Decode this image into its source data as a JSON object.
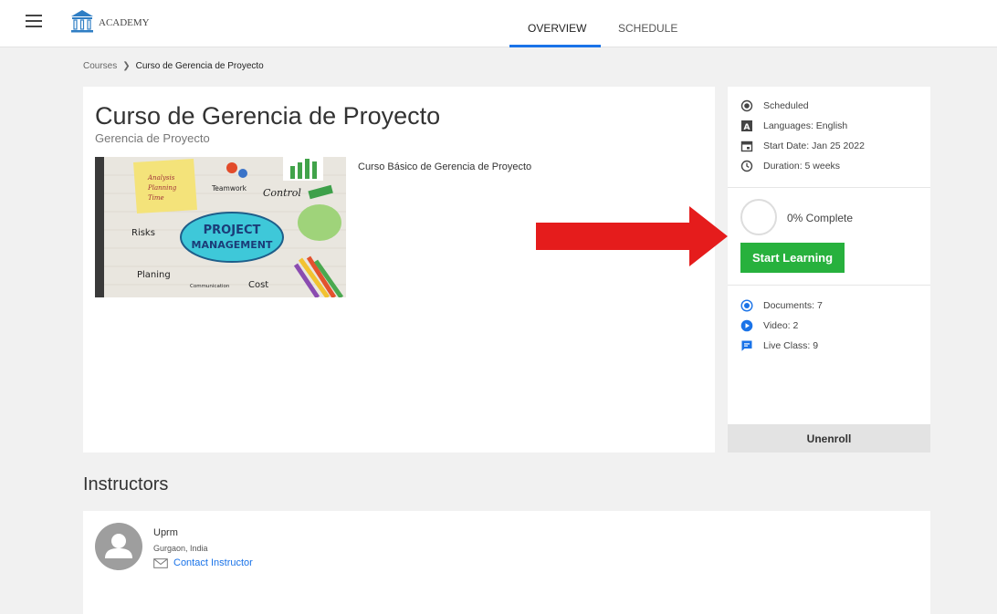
{
  "header": {
    "brand": "ACADEMY",
    "tabs": [
      {
        "label": "OVERVIEW",
        "active": true
      },
      {
        "label": "SCHEDULE",
        "active": false
      }
    ]
  },
  "breadcrumb": {
    "root": "Courses",
    "current": "Curso de Gerencia de Proyecto"
  },
  "course": {
    "title": "Curso de Gerencia de Proyecto",
    "subtitle": "Gerencia de Proyecto",
    "description": "Curso Básico de Gerencia de Proyecto",
    "image_text": {
      "center_line1": "PROJECT",
      "center_line2": "MANAGEMENT",
      "notes": [
        "Analysis",
        "Planning",
        "Time"
      ],
      "labels": [
        "Teamwork",
        "Control",
        "Risks",
        "Planing",
        "Communication",
        "Cost"
      ]
    }
  },
  "sidebar": {
    "meta": [
      {
        "icon": "radio-dot-icon",
        "text": "Scheduled"
      },
      {
        "icon": "language-icon",
        "text": "Languages: English"
      },
      {
        "icon": "calendar-icon",
        "text": "Start Date: Jan 25 2022"
      },
      {
        "icon": "clock-icon",
        "text": "Duration: 5 weeks"
      }
    ],
    "progress": {
      "percent": 0,
      "label": "0% Complete"
    },
    "start_button": "Start Learning",
    "resources": [
      {
        "icon": "document-icon",
        "text": "Documents: 7"
      },
      {
        "icon": "video-icon",
        "text": "Video: 2"
      },
      {
        "icon": "live-class-icon",
        "text": "Live Class: 9"
      }
    ],
    "unenroll": "Unenroll"
  },
  "instructors": {
    "heading": "Instructors",
    "items": [
      {
        "name": "Uprm",
        "location": "Gurgaon, India",
        "contact_label": "Contact Instructor"
      }
    ]
  },
  "colors": {
    "accent": "#1a73e8",
    "start_button": "#27b13d",
    "arrow": "#e51c1c"
  }
}
